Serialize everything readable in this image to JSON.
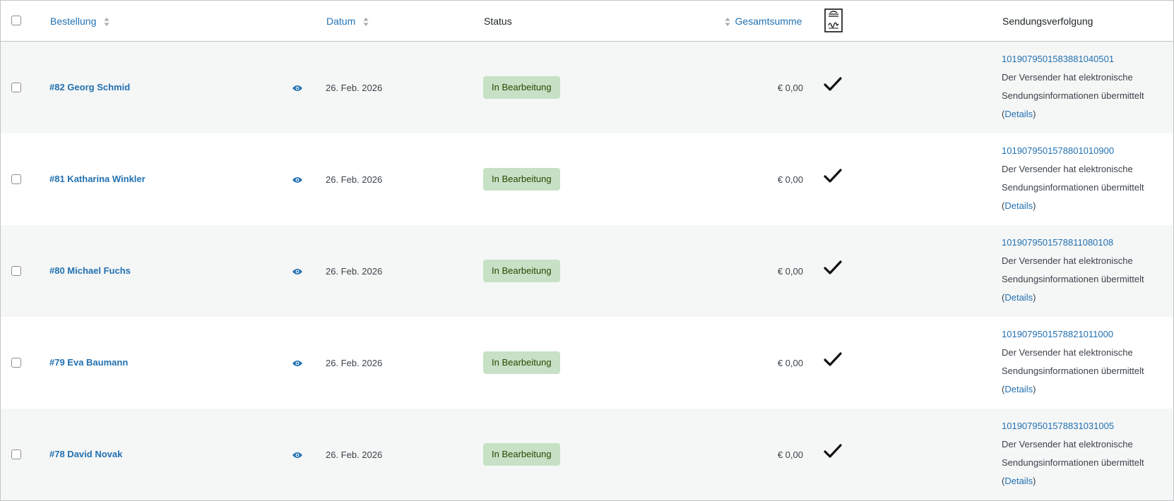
{
  "header": {
    "order_label": "Bestellung",
    "date_label": "Datum",
    "status_label": "Status",
    "total_label": "Gesamtsumme",
    "signature_icon": "signature-icon",
    "tracking_label": "Sendungsverfolgung"
  },
  "colors": {
    "link": "#2271b1",
    "status_badge_bg": "#c6e1c6",
    "status_badge_text": "#2c4700",
    "row_alt_bg": "#f5f6f6"
  },
  "orders": [
    {
      "order": "#82 Georg Schmid",
      "date": "26. Feb. 2026",
      "status": "In Bearbeitung",
      "total": "€ 0,00",
      "tracking_number": "1019079501583881040501",
      "tracking_message": "Der Versender hat elektronische Sendungsinformationen übermittelt",
      "details_label": "Details"
    },
    {
      "order": "#81 Katharina Winkler",
      "date": "26. Feb. 2026",
      "status": "In Bearbeitung",
      "total": "€ 0,00",
      "tracking_number": "1019079501578801010900",
      "tracking_message": "Der Versender hat elektronische Sendungsinformationen übermittelt",
      "details_label": "Details"
    },
    {
      "order": "#80 Michael Fuchs",
      "date": "26. Feb. 2026",
      "status": "In Bearbeitung",
      "total": "€ 0,00",
      "tracking_number": "1019079501578811080108",
      "tracking_message": "Der Versender hat elektronische Sendungsinformationen übermittelt",
      "details_label": "Details"
    },
    {
      "order": "#79 Eva Baumann",
      "date": "26. Feb. 2026",
      "status": "In Bearbeitung",
      "total": "€ 0,00",
      "tracking_number": "1019079501578821011000",
      "tracking_message": "Der Versender hat elektronische Sendungsinformationen übermittelt",
      "details_label": "Details"
    },
    {
      "order": "#78 David Novak",
      "date": "26. Feb. 2026",
      "status": "In Bearbeitung",
      "total": "€ 0,00",
      "tracking_number": "1019079501578831031005",
      "tracking_message": "Der Versender hat elektronische Sendungsinformationen übermittelt",
      "details_label": "Details"
    }
  ]
}
